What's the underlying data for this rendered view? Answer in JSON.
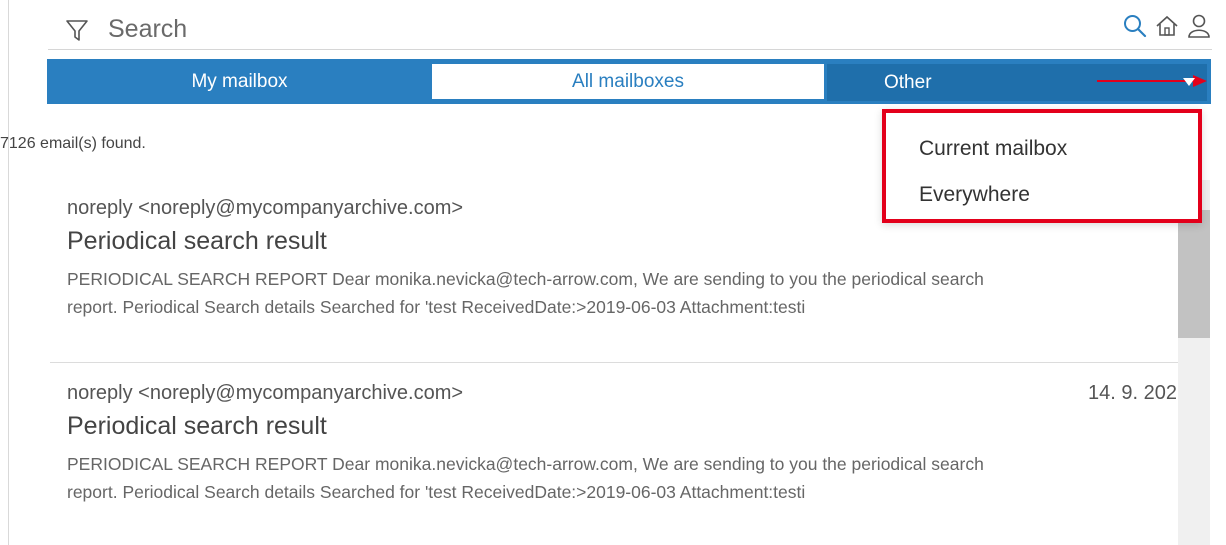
{
  "search": {
    "placeholder": "Search"
  },
  "icons": {
    "filter": "funnel-icon",
    "search": "search-icon",
    "home": "home-icon",
    "user": "user-icon",
    "caret": "caret-down-icon"
  },
  "colors": {
    "tab_blue": "#2a7fc0",
    "tab_active_dark": "#1f6fab",
    "highlight_red": "#e3001b"
  },
  "tabs": {
    "my": "My mailbox",
    "all": "All mailboxes",
    "other": "Other"
  },
  "results": {
    "count_text": "7126 email(s) found."
  },
  "dropdown": {
    "items": [
      "Current mailbox",
      "Everywhere"
    ]
  },
  "messages": [
    {
      "sender": "noreply <noreply@mycompanyarchive.com>",
      "subject": "Periodical search result",
      "date": "",
      "preview_line1": "PERIODICAL SEARCH REPORT Dear monika.nevicka@tech-arrow.com, We are sending to you the periodical search",
      "preview_line2": "report. Periodical Search details Searched for 'test ReceivedDate:>2019-06-03 Attachment:testi"
    },
    {
      "sender": "noreply <noreply@mycompanyarchive.com>",
      "subject": "Periodical search result",
      "date": "14. 9. 202",
      "preview_line1": "PERIODICAL SEARCH REPORT Dear monika.nevicka@tech-arrow.com, We are sending to you the periodical search",
      "preview_line2": "report. Periodical Search details Searched for 'test ReceivedDate:>2019-06-03 Attachment:testi"
    }
  ]
}
